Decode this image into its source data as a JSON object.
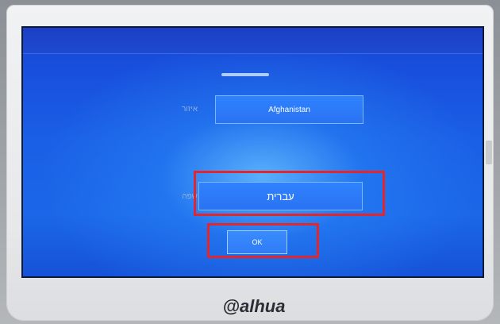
{
  "region": {
    "label": "איזור",
    "value": "Afghanistan"
  },
  "language": {
    "label": "שפה",
    "value": "עברית"
  },
  "actions": {
    "ok_label": "OK"
  },
  "device": {
    "brand": "alhua"
  },
  "colors": {
    "screen_blue": "#1b5fe6",
    "highlight_red": "#e3262c"
  },
  "icons": {
    "brand_logo": "dahua-logo"
  }
}
